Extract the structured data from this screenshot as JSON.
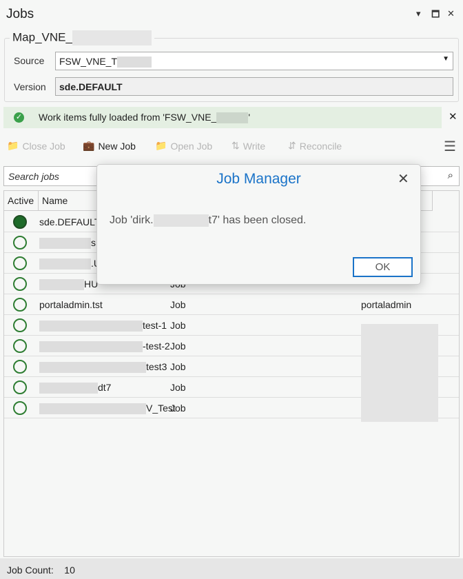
{
  "window": {
    "title": "Jobs"
  },
  "group": {
    "title": "Map_VNE_",
    "source_label": "Source",
    "source_value": "FSW_VNE_T",
    "version_label": "Version",
    "version_value": "sde.DEFAULT"
  },
  "notification": {
    "text": "Work items fully loaded from 'FSW_VNE_",
    "text_end": "'"
  },
  "toolbar": {
    "close_job": "Close Job",
    "new_job": "New Job",
    "open_job": "Open Job",
    "write": "Write",
    "reconcile": "Reconcile"
  },
  "search": {
    "placeholder": "Search jobs"
  },
  "table": {
    "headers": [
      "Active",
      "Name"
    ],
    "rows": [
      {
        "active": true,
        "name": "sde.DEFAULT",
        "type": "",
        "owner": ""
      },
      {
        "active": false,
        "name": "s",
        "type": "",
        "owner": ""
      },
      {
        "active": false,
        "name": ".U",
        "type": "",
        "owner": ""
      },
      {
        "active": false,
        "name": "HU",
        "type": "Job",
        "owner": ""
      },
      {
        "active": false,
        "name": "portaladmin.tst",
        "type": "Job",
        "owner": "portaladmin"
      },
      {
        "active": false,
        "name": "test-1",
        "type": "Job",
        "owner": ""
      },
      {
        "active": false,
        "name": "-test-2",
        "type": "Job",
        "owner": ""
      },
      {
        "active": false,
        "name": "test3",
        "type": "Job",
        "owner": ""
      },
      {
        "active": false,
        "name": "dt7",
        "type": "Job",
        "owner": ""
      },
      {
        "active": false,
        "name": "V_Test",
        "type": "Job",
        "owner": ""
      }
    ]
  },
  "footer": {
    "label": "Job Count:",
    "count": "10"
  },
  "dialog": {
    "title": "Job Manager",
    "message_start": "Job 'dirk.",
    "message_end": "t7' has been closed.",
    "ok": "OK"
  },
  "colors": {
    "accent": "#1a73c8",
    "active_green": "#1e6b2a",
    "notice_bg": "#e4efe2"
  }
}
